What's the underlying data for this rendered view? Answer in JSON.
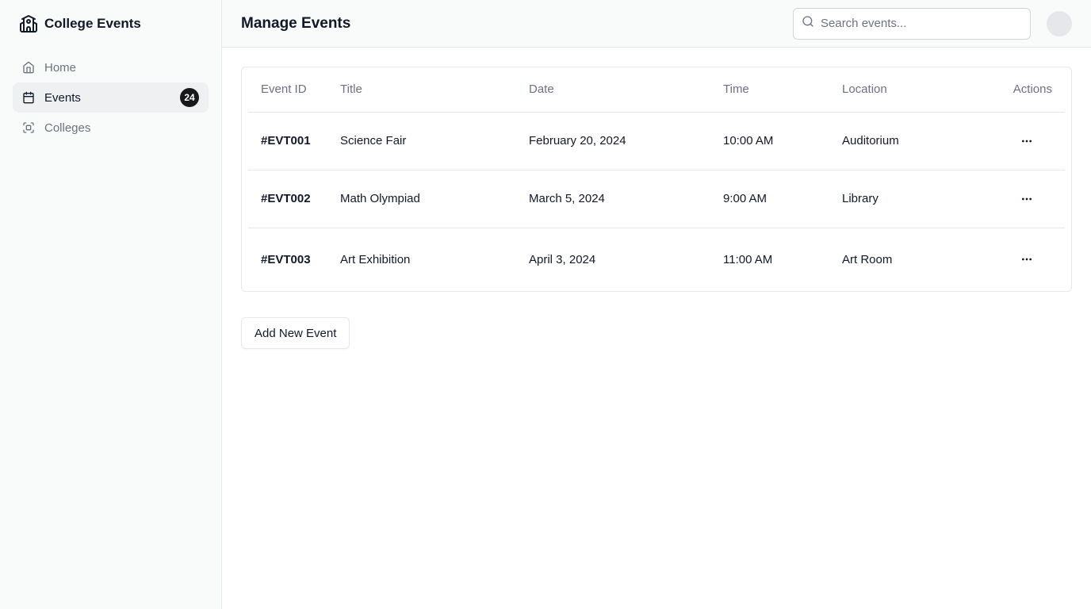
{
  "app": {
    "name": "College Events",
    "logo_icon": "school-icon"
  },
  "sidebar": {
    "items": [
      {
        "label": "Home",
        "icon": "home-icon",
        "active": false
      },
      {
        "label": "Events",
        "icon": "calendar-icon",
        "active": true,
        "badge": "24"
      },
      {
        "label": "Colleges",
        "icon": "scan-icon",
        "active": false
      }
    ]
  },
  "header": {
    "title": "Manage Events",
    "search_placeholder": "Search events..."
  },
  "table": {
    "columns": [
      "Event ID",
      "Title",
      "Date",
      "Time",
      "Location",
      "Actions"
    ],
    "rows": [
      {
        "id": "#EVT001",
        "title": "Science Fair",
        "date": "February 20, 2024",
        "time": "10:00 AM",
        "location": "Auditorium"
      },
      {
        "id": "#EVT002",
        "title": "Math Olympiad",
        "date": "March 5, 2024",
        "time": "9:00 AM",
        "location": "Library"
      },
      {
        "id": "#EVT003",
        "title": "Art Exhibition",
        "date": "April 3, 2024",
        "time": "11:00 AM",
        "location": "Art Room"
      }
    ]
  },
  "actions": {
    "add_label": "Add New Event"
  },
  "colors": {
    "accent": "#18181b",
    "border": "#e5e7eb",
    "muted_text": "#6b7280"
  }
}
